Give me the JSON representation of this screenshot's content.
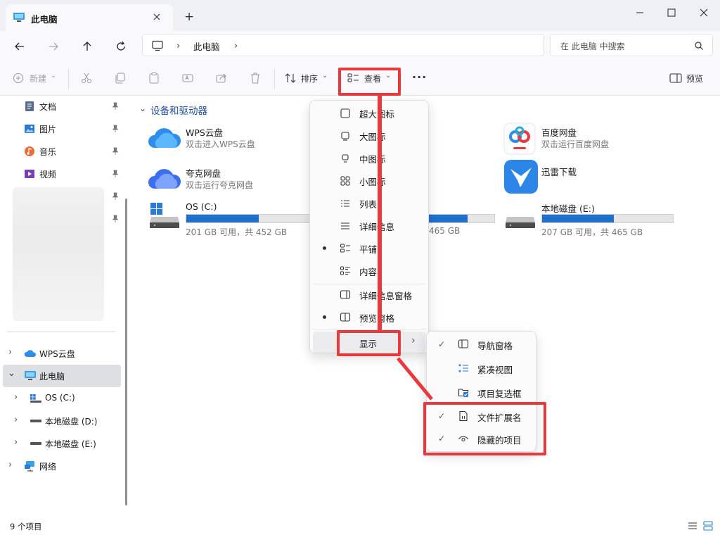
{
  "window": {
    "tab_title": "此电脑",
    "new_tab_symbol": "+",
    "minimize": "minimize-icon",
    "maximize": "maximize-icon",
    "close": "close-icon"
  },
  "address": {
    "crumbs": [
      "此电脑"
    ],
    "search_placeholder": "在 此电脑 中搜索"
  },
  "toolbar": {
    "new_label": "新建",
    "sort_label": "排序",
    "view_label": "查看",
    "preview_label": "预览",
    "more_symbol": "···"
  },
  "nav": {
    "quick_access": [
      {
        "label": "文档",
        "icon": "document-icon"
      },
      {
        "label": "图片",
        "icon": "picture-icon"
      },
      {
        "label": "音乐",
        "icon": "music-icon"
      },
      {
        "label": "视频",
        "icon": "video-icon"
      }
    ],
    "tree": [
      {
        "label": "WPS云盘",
        "icon": "cloud-icon"
      },
      {
        "label": "此电脑",
        "icon": "computer-icon",
        "selected": true
      },
      {
        "label": "OS (C:)",
        "icon": "windows-drive-icon"
      },
      {
        "label": "本地磁盘 (D:)",
        "icon": "drive-icon"
      },
      {
        "label": "本地磁盘 (E:)",
        "icon": "drive-icon"
      },
      {
        "label": "网络",
        "icon": "network-icon"
      }
    ]
  },
  "content": {
    "section_title": "设备和驱动器",
    "items": [
      {
        "name": "WPS云盘",
        "sub": "双击进入WPS云盘",
        "icon": "wps-cloud-icon"
      },
      {
        "name": "百度网盘",
        "sub": "双击运行百度网盘",
        "icon": "baidu-netdisk-icon"
      },
      {
        "name": "夸克网盘",
        "sub": "双击运行夸克网盘",
        "icon": "quark-cloud-icon"
      },
      {
        "name": "迅雷下载",
        "sub": "",
        "icon": "xunlei-icon"
      }
    ],
    "drives": [
      {
        "name": "OS (C:)",
        "free": "201 GB 可用，共 452 GB",
        "used_fraction": 0.56
      },
      {
        "name": "",
        "free": "465 GB",
        "used_fraction": 0.6
      },
      {
        "name": "本地磁盘 (E:)",
        "free": "207 GB 可用，共 465 GB",
        "used_fraction": 0.55
      }
    ]
  },
  "view_menu": {
    "items": [
      {
        "label": "超大图标",
        "icon": "extra-large-icons-icon",
        "selected": false
      },
      {
        "label": "大图标",
        "icon": "large-icons-icon",
        "selected": false
      },
      {
        "label": "中图标",
        "icon": "medium-icons-icon",
        "selected": false
      },
      {
        "label": "小图标",
        "icon": "small-icons-icon",
        "selected": false
      },
      {
        "label": "列表",
        "icon": "list-icon",
        "selected": false
      },
      {
        "label": "详细信息",
        "icon": "details-icon",
        "selected": false
      },
      {
        "label": "平铺",
        "icon": "tiles-icon",
        "selected": true
      },
      {
        "label": "内容",
        "icon": "content-icon",
        "selected": false
      }
    ],
    "panes": [
      {
        "label": "详细信息窗格",
        "icon": "details-pane-icon",
        "selected": false
      },
      {
        "label": "预览窗格",
        "icon": "preview-pane-icon",
        "selected": true
      }
    ],
    "show_label": "显示"
  },
  "show_submenu": {
    "items": [
      {
        "label": "导航窗格",
        "checked": true,
        "icon": "navigation-pane-icon"
      },
      {
        "label": "紧凑视图",
        "checked": false,
        "icon": "compact-view-icon"
      },
      {
        "label": "项目复选框",
        "checked": false,
        "icon": "item-checkbox-icon"
      },
      {
        "label": "文件扩展名",
        "checked": true,
        "icon": "file-extension-icon"
      },
      {
        "label": "隐藏的项目",
        "checked": true,
        "icon": "hidden-items-icon"
      }
    ]
  },
  "status": {
    "item_count": "9 个项目"
  },
  "colors": {
    "accent": "#1f6fcd",
    "annotation": "#e8393f",
    "section_title": "#1f4e9b"
  }
}
